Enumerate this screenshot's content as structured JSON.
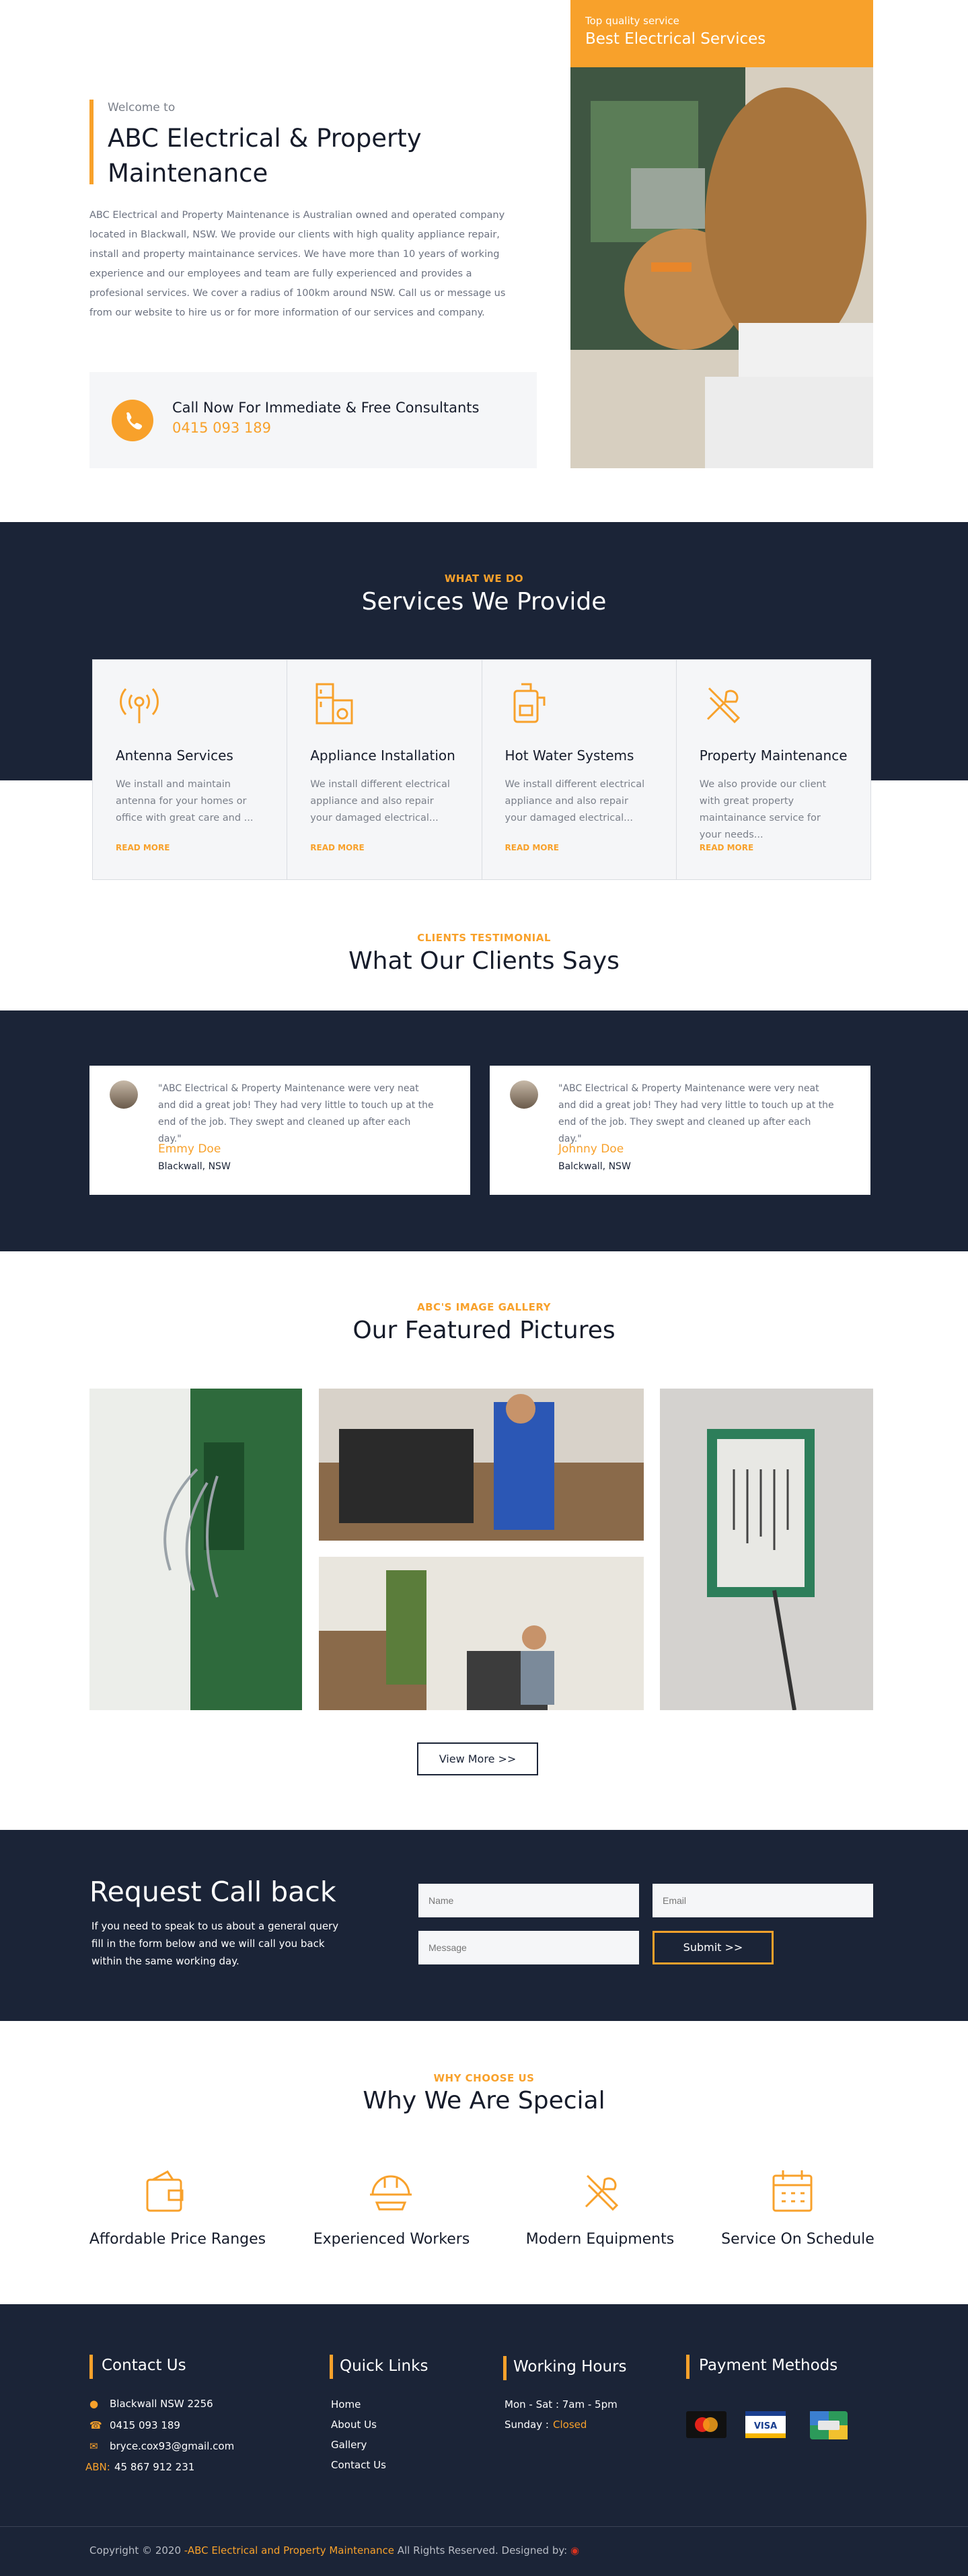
{
  "intro": {
    "welcome": "Welcome to",
    "title": "ABC Electrical & Property Maintenance",
    "text": "ABC Electrical and Property Maintenance is Australian owned and operated company located in Blackwall, NSW. We provide our clients with high quality appliance repair, install and property maintainance services. We have more than 10 years of working experience and our employees and team are fully experienced and provides a profesional services. We cover a radius of 100km around NSW. Call us or message us from our website to hire us or for more information of our services and company.",
    "call_heading": "Call Now For Immediate & Free Consultants",
    "call_number": "0415 093 189"
  },
  "hero": {
    "small": "Top quality service",
    "large": "Best Electrical Services"
  },
  "services": {
    "label": "WHAT WE DO",
    "title": "Services We Provide",
    "items": [
      {
        "title": "Antenna Services",
        "desc": "We install and maintain antenna for your homes or office with great care and ...",
        "more": "READ MORE",
        "icon": "antenna-icon"
      },
      {
        "title": "Appliance Installation",
        "desc": "We install different electrical appliance and also repair your damaged electrical...",
        "more": "READ MORE",
        "icon": "appliance-icon"
      },
      {
        "title": "Hot Water Systems",
        "desc": "We install different electrical appliance and also repair your damaged electrical...",
        "more": "READ MORE",
        "icon": "water-heater-icon"
      },
      {
        "title": "Property Maintenance",
        "desc": "We also provide our client with great property maintainance service for your needs...",
        "more": "READ MORE",
        "icon": "tools-icon"
      }
    ]
  },
  "testimonials": {
    "label": "CLIENTS TESTIMONIAL",
    "title": "What Our Clients Says",
    "items": [
      {
        "quote": "\"ABC Electrical & Property Maintenance were very neat and did a great job! They had very little to touch up at the end of the job. They swept and cleaned up after each day.\"",
        "name": "Emmy Doe",
        "location": "Blackwall, NSW"
      },
      {
        "quote": "\"ABC Electrical & Property Maintenance were very neat and did a great job! They had very little to touch up at the end of the job. They swept and cleaned up after each day.\"",
        "name": "Johnny Doe",
        "location": "Balckwall, NSW"
      }
    ]
  },
  "gallery": {
    "label": "ABC'S IMAGE GALLERY",
    "title": "Our Featured Pictures",
    "view_more": "View More >>"
  },
  "callback": {
    "title": "Request Call back",
    "text": "If you need to speak to us about a general query fill in the form below and we will call you back within the same working day.",
    "name_placeholder": "Name",
    "email_placeholder": "Email",
    "message_placeholder": "Message",
    "submit": "Submit >>"
  },
  "why": {
    "label": "WHY CHOOSE US",
    "title": "Why We Are Special",
    "items": [
      {
        "title": "Affordable Price Ranges",
        "icon": "wallet-icon"
      },
      {
        "title": "Experienced Workers",
        "icon": "helmet-icon"
      },
      {
        "title": "Modern Equipments",
        "icon": "tools-icon"
      },
      {
        "title": "Service On Schedule",
        "icon": "calendar-icon"
      }
    ]
  },
  "footer": {
    "contact": {
      "heading": "Contact Us",
      "address": "Blackwall NSW 2256",
      "phone": "0415 093 189",
      "email": "bryce.cox93@gmail.com",
      "abn_label": "ABN:",
      "abn": "45 867 912 231"
    },
    "links": {
      "heading": "Quick Links",
      "items": [
        "Home",
        "About Us",
        "Gallery",
        "Contact Us"
      ]
    },
    "hours": {
      "heading": "Working Hours",
      "weekdays": "Mon - Sat : 7am - 5pm",
      "sunday_label": "Sunday :",
      "sunday_value": "Closed"
    },
    "payment": {
      "heading": "Payment Methods"
    },
    "copyright_pre": "Copyright © 2020",
    "copyright_brand": "-ABC Electrical and Property Maintenance",
    "copyright_post": "All Rights Reserved. Designed by:"
  },
  "colors": {
    "accent": "#f8a12b",
    "navy": "#1b2437"
  }
}
